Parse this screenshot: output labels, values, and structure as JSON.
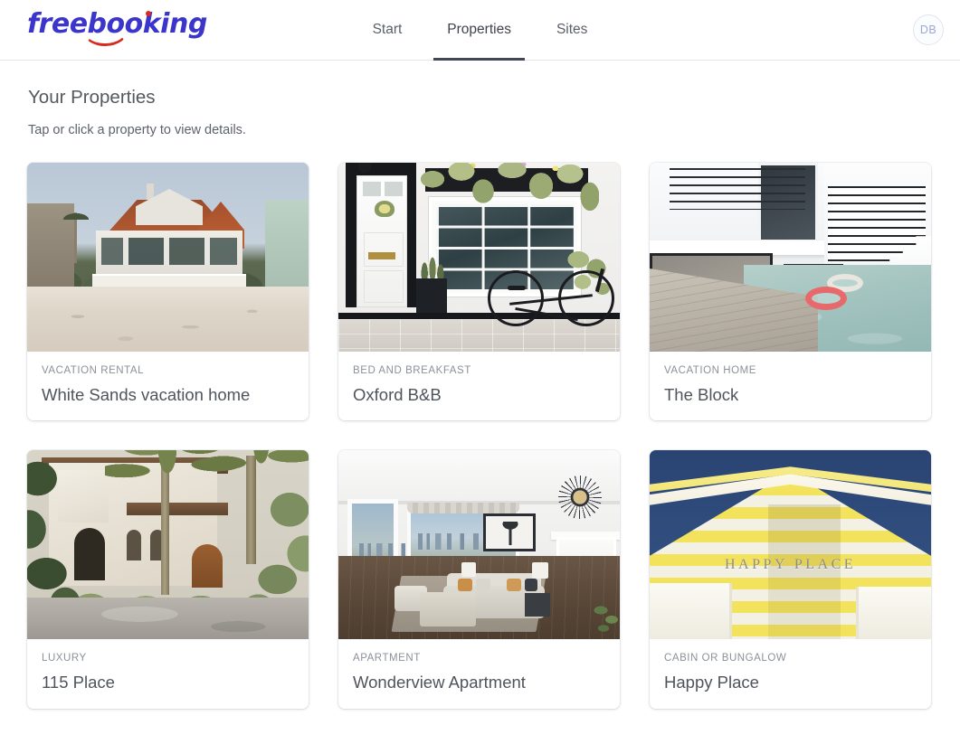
{
  "header": {
    "logo_text": "freebooking",
    "nav": [
      {
        "label": "Start",
        "active": false
      },
      {
        "label": "Properties",
        "active": true
      },
      {
        "label": "Sites",
        "active": false
      }
    ],
    "avatar_initials": "DB"
  },
  "main": {
    "title": "Your Properties",
    "subtitle": "Tap or click a property to view details.",
    "properties": [
      {
        "category": "VACATION RENTAL",
        "name": "White Sands vacation home"
      },
      {
        "category": "BED AND BREAKFAST",
        "name": "Oxford B&B"
      },
      {
        "category": "VACATION HOME",
        "name": "The Block"
      },
      {
        "category": "LUXURY",
        "name": "115 Place"
      },
      {
        "category": "APARTMENT",
        "name": "Wonderview Apartment"
      },
      {
        "category": "CABIN OR BUNGALOW",
        "name": "Happy Place"
      }
    ]
  },
  "images": {
    "hut_sign_text": "HAPPY PLACE"
  },
  "colors": {
    "logo_blue": "#3b35cc",
    "logo_red": "#d62b1f",
    "active_tab_underline": "#434654",
    "card_category_text": "#8b9099",
    "card_title_text": "#4f545c",
    "header_border": "#e3e6ea"
  }
}
